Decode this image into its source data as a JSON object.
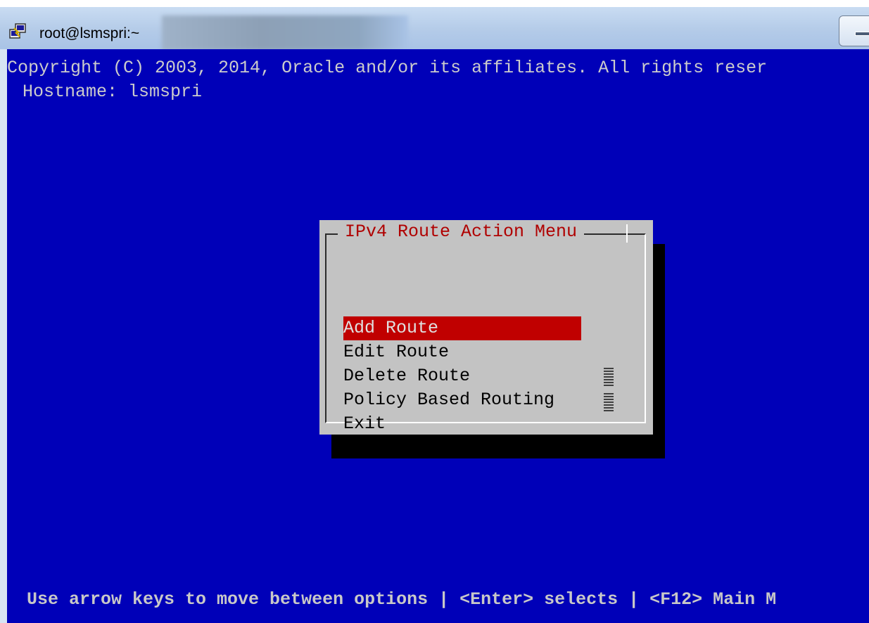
{
  "window": {
    "title": "root@lsmspri:~"
  },
  "terminal": {
    "copyright": "Copyright (C) 2003, 2014, Oracle and/or its affiliates. All rights reser",
    "hostname": "Hostname: lsmspri",
    "help": "Use arrow keys to move between options | <Enter> selects | <F12> Main M"
  },
  "dialog": {
    "title": "IPv4 Route Action Menu",
    "items": [
      {
        "label": "Add Route",
        "selected": true
      },
      {
        "label": "Edit Route",
        "selected": false
      },
      {
        "label": "Delete Route",
        "selected": false
      },
      {
        "label": "Policy Based Routing",
        "selected": false
      },
      {
        "label": "Exit",
        "selected": false
      }
    ]
  },
  "colors": {
    "terminal_bg": "#0000b8",
    "dialog_bg": "#c3c3c3",
    "selection": "#c00000",
    "title_text": "#b00000"
  }
}
